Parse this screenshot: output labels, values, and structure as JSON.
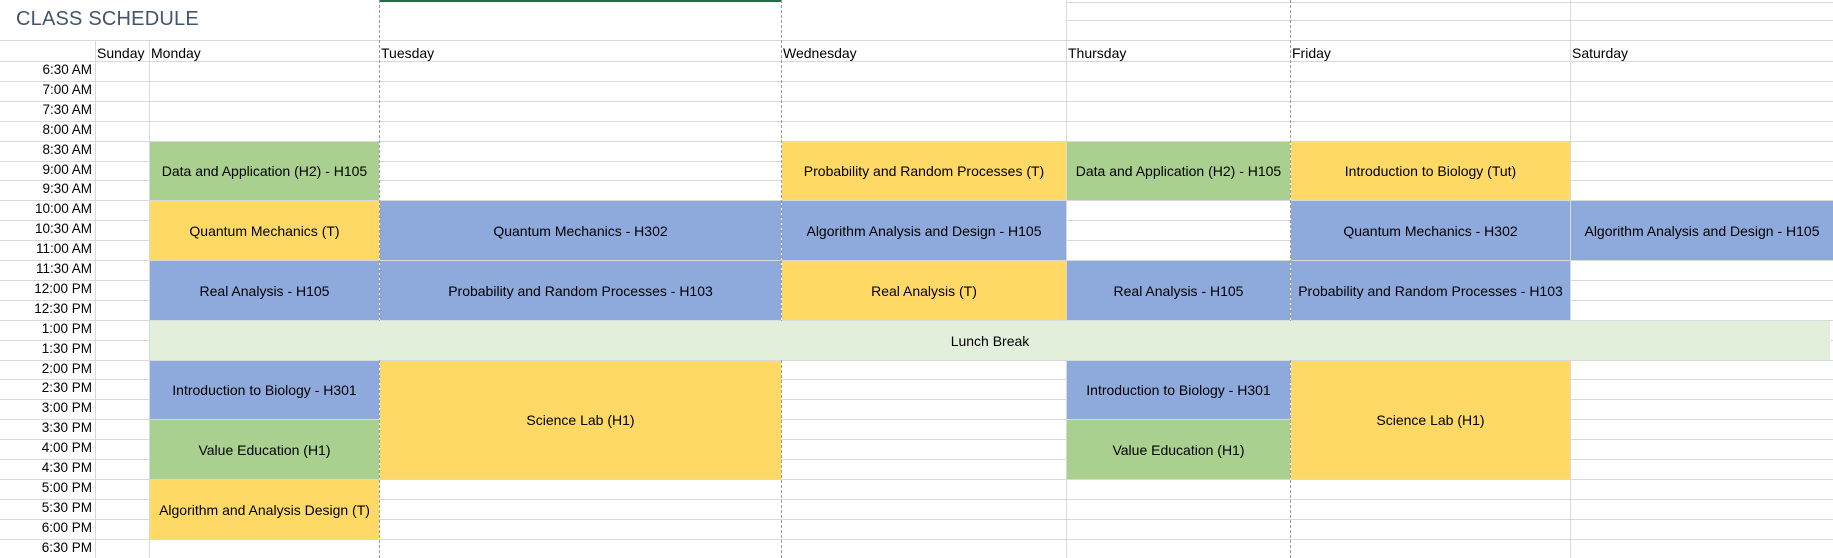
{
  "title": "CLASS SCHEDULE",
  "days": [
    "Sunday",
    "Monday",
    "Tuesday",
    "Wednesday",
    "Thursday",
    "Friday",
    "Saturday"
  ],
  "times": [
    "6:30 AM",
    "7:00 AM",
    "7:30 AM",
    "8:00 AM",
    "8:30 AM",
    "9:00 AM",
    "9:30 AM",
    "10:00 AM",
    "10:30 AM",
    "11:00 AM",
    "11:30 AM",
    "12:00 PM",
    "12:30 PM",
    "1:00 PM",
    "1:30 PM",
    "2:00 PM",
    "2:30 PM",
    "3:00 PM",
    "3:30 PM",
    "4:00 PM",
    "4:30 PM",
    "5:00 PM",
    "5:30 PM",
    "6:00 PM",
    "6:30 PM"
  ],
  "colors": {
    "green": "#a9d08e",
    "yellow": "#ffd966",
    "blue": "#8ea9db",
    "lunch": "#e2efda",
    "title": "#44546a"
  },
  "blocks": [
    {
      "label": "Data and Application (H2) - H105",
      "day": "Monday",
      "start": "8:30 AM",
      "end": "10:00 AM",
      "color": "green"
    },
    {
      "label": "Quantum Mechanics (T)",
      "day": "Monday",
      "start": "10:00 AM",
      "end": "11:30 AM",
      "color": "yellow"
    },
    {
      "label": "Real Analysis - H105",
      "day": "Monday",
      "start": "11:30 AM",
      "end": "1:00 PM",
      "color": "blue"
    },
    {
      "label": "Introduction to Biology - H301",
      "day": "Monday",
      "start": "2:00 PM",
      "end": "3:30 PM",
      "color": "blue"
    },
    {
      "label": "Value Education (H1)",
      "day": "Monday",
      "start": "3:30 PM",
      "end": "5:00 PM",
      "color": "green"
    },
    {
      "label": "Algorithm and Analysis Design (T)",
      "day": "Monday",
      "start": "5:00 PM",
      "end": "6:30 PM",
      "color": "yellow"
    },
    {
      "label": "Quantum Mechanics - H302",
      "day": "Tuesday",
      "start": "10:00 AM",
      "end": "11:30 AM",
      "color": "blue"
    },
    {
      "label": "Probability and Random Processes - H103",
      "day": "Tuesday",
      "start": "11:30 AM",
      "end": "1:00 PM",
      "color": "blue"
    },
    {
      "label": "Science Lab (H1)",
      "day": "Tuesday",
      "start": "2:00 PM",
      "end": "5:00 PM",
      "color": "yellow"
    },
    {
      "label": "Probability and Random Processes (T)",
      "day": "Wednesday",
      "start": "8:30 AM",
      "end": "10:00 AM",
      "color": "yellow"
    },
    {
      "label": "Algorithm Analysis and Design - H105",
      "day": "Wednesday",
      "start": "10:00 AM",
      "end": "11:30 AM",
      "color": "blue"
    },
    {
      "label": "Real Analysis (T)",
      "day": "Wednesday",
      "start": "11:30 AM",
      "end": "1:00 PM",
      "color": "yellow"
    },
    {
      "label": "Data and Application (H2) - H105",
      "day": "Thursday",
      "start": "8:30 AM",
      "end": "10:00 AM",
      "color": "green"
    },
    {
      "label": "Real Analysis - H105",
      "day": "Thursday",
      "start": "11:30 AM",
      "end": "1:00 PM",
      "color": "blue"
    },
    {
      "label": "Introduction to Biology - H301",
      "day": "Thursday",
      "start": "2:00 PM",
      "end": "3:30 PM",
      "color": "blue"
    },
    {
      "label": "Value Education (H1)",
      "day": "Thursday",
      "start": "3:30 PM",
      "end": "5:00 PM",
      "color": "green"
    },
    {
      "label": "Introduction to Biology (Tut)",
      "day": "Friday",
      "start": "8:30 AM",
      "end": "10:00 AM",
      "color": "yellow"
    },
    {
      "label": "Quantum Mechanics - H302",
      "day": "Friday",
      "start": "10:00 AM",
      "end": "11:30 AM",
      "color": "blue"
    },
    {
      "label": "Probability and Random Processes - H103",
      "day": "Friday",
      "start": "11:30 AM",
      "end": "1:00 PM",
      "color": "blue"
    },
    {
      "label": "Science Lab (H1)",
      "day": "Friday",
      "start": "2:00 PM",
      "end": "5:00 PM",
      "color": "yellow"
    },
    {
      "label": "Algorithm Analysis and Design - H105",
      "day": "Saturday",
      "start": "10:00 AM",
      "end": "11:30 AM",
      "color": "blue"
    }
  ],
  "lunch": {
    "label": "Lunch Break",
    "start": "1:00 PM",
    "end": "2:00 PM",
    "color": "lunch"
  }
}
